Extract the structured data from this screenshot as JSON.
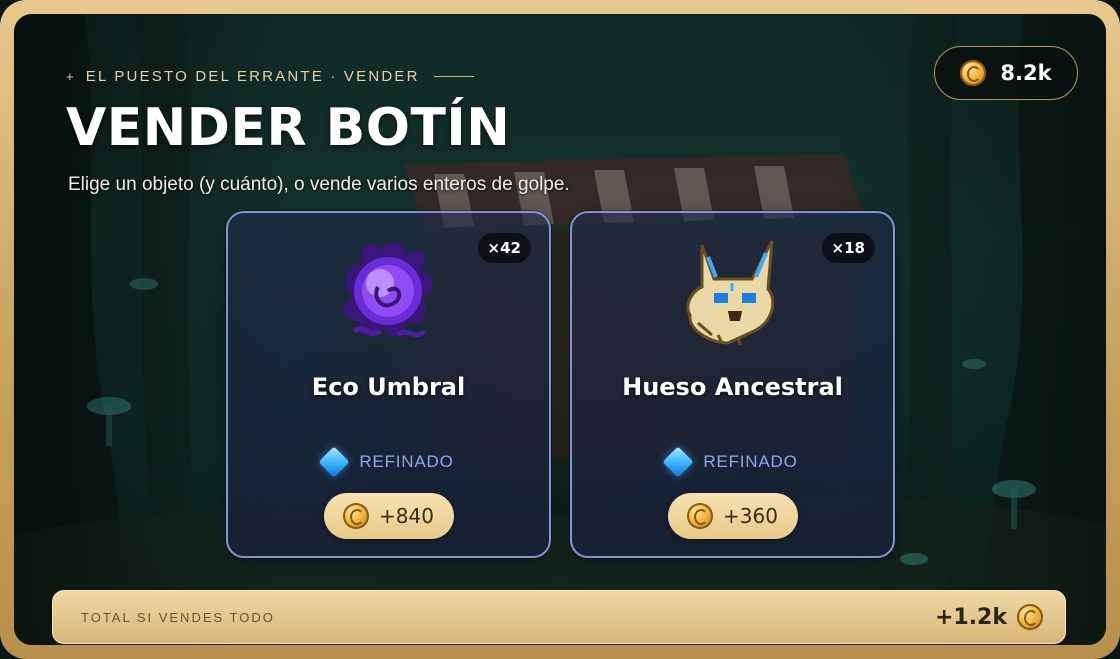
{
  "header": {
    "eyebrow_spark": "+",
    "eyebrow": "EL PUESTO DEL ERRANTE · VENDER",
    "title": "VENDER BOTÍN",
    "subtitle": "Elige un objeto (y cuánto), o vende varios enteros de golpe."
  },
  "balance": {
    "icon": "coin-icon",
    "amount": "8.2k"
  },
  "items": [
    {
      "name": "Eco Umbral",
      "quantity": "×42",
      "icon": "purple-orb-icon",
      "rarity": "REFINADO",
      "rarity_icon": "blue-diamond-icon",
      "price": "+840"
    },
    {
      "name": "Hueso Ancestral",
      "quantity": "×18",
      "icon": "wolf-skull-icon",
      "rarity": "REFINADO",
      "rarity_icon": "blue-diamond-icon",
      "price": "+360"
    }
  ],
  "total": {
    "label": "TOTAL SI VENDES TODO",
    "amount": "+1.2k"
  },
  "colors": {
    "frame_gold": "#c9a463",
    "card_border": "#7f95d6",
    "rarity_text": "#8ea6e8",
    "price_pill": "#f0d59d"
  }
}
